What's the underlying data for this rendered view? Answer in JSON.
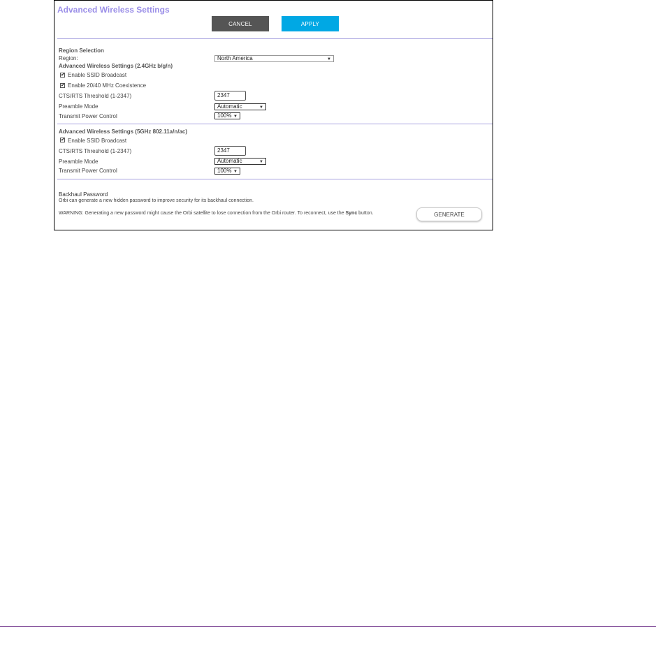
{
  "page": {
    "title": "Advanced Wireless Settings"
  },
  "toolbar": {
    "cancel_label": "CANCEL",
    "apply_label": "APPLY"
  },
  "region": {
    "section_title": "Region Selection",
    "label": "Region:",
    "selected": "North America"
  },
  "band24": {
    "section_title": "Advanced Wireless Settings (2.4GHz b/g/n)",
    "ssid_broadcast_label": "Enable SSID Broadcast",
    "ssid_broadcast_checked": true,
    "coexistence_label": "Enable 20/40 MHz Coexistence",
    "coexistence_checked": true,
    "cts_label": "CTS/RTS Threshold (1-2347)",
    "cts_value": "2347",
    "preamble_label": "Preamble Mode",
    "preamble_value": "Automatic",
    "power_label": "Transmit Power Control",
    "power_value": "100%"
  },
  "band5": {
    "section_title": "Advanced Wireless Settings (5GHz 802.11a/n/ac)",
    "ssid_broadcast_label": "Enable SSID Broadcast",
    "ssid_broadcast_checked": true,
    "cts_label": "CTS/RTS Threshold (1-2347)",
    "cts_value": "2347",
    "preamble_label": "Preamble Mode",
    "preamble_value": "Automatic",
    "power_label": "Transmit Power Control",
    "power_value": "100%"
  },
  "backhaul": {
    "section_title": "Backhaul Password",
    "description": "Orbi can generate a new hidden password to improve security for its backhaul connection.",
    "warning_prefix": "WARNING: Generating a new password might cause the Orbi satellite to lose connection from the Orbi router. To reconnect, use the ",
    "warning_bold": "Sync",
    "warning_suffix": " button.",
    "generate_label": "GENERATE"
  },
  "icons": {
    "dropdown": "▼",
    "check": "✔"
  },
  "colors": {
    "title": "#9b8fe8",
    "cancel_bg": "#555555",
    "apply_bg": "#00a8e4",
    "rule": "#a9a3e0",
    "footer_rule": "#6b2d87"
  }
}
